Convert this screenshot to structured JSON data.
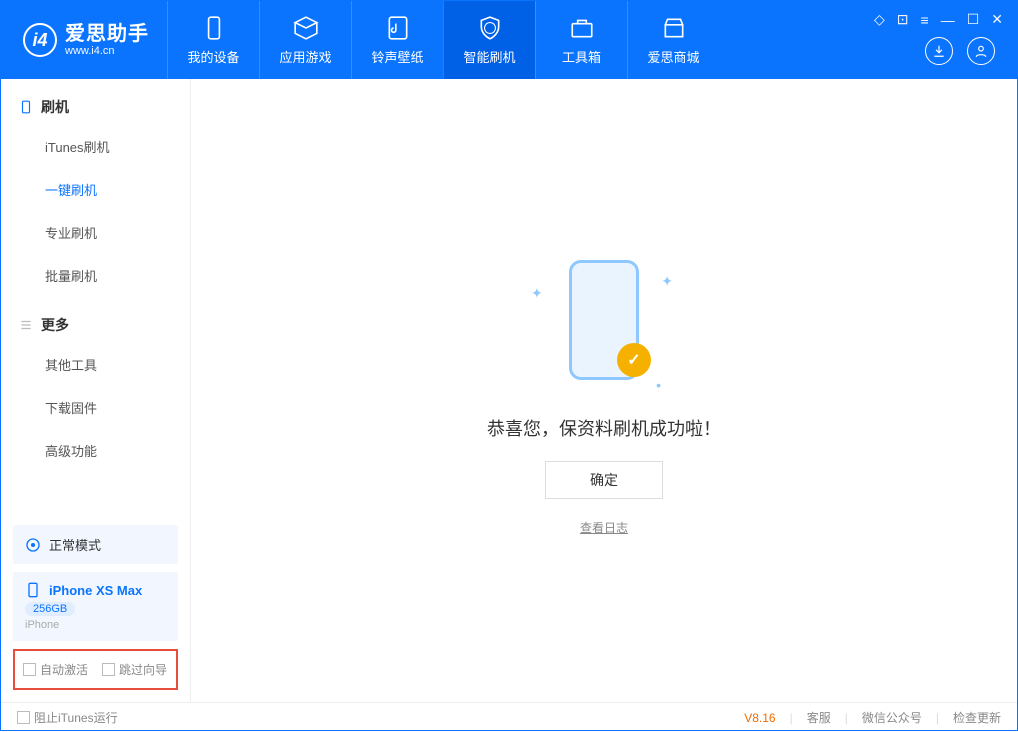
{
  "app": {
    "name": "爱思助手",
    "url": "www.i4.cn"
  },
  "nav": {
    "items": [
      {
        "label": "我的设备",
        "icon": "device"
      },
      {
        "label": "应用游戏",
        "icon": "cube"
      },
      {
        "label": "铃声壁纸",
        "icon": "music"
      },
      {
        "label": "智能刷机",
        "icon": "shield",
        "active": true
      },
      {
        "label": "工具箱",
        "icon": "toolbox"
      },
      {
        "label": "爱思商城",
        "icon": "shop"
      }
    ]
  },
  "sidebar": {
    "sections": [
      {
        "title": "刷机",
        "icon": "phone-icon",
        "items": [
          "iTunes刷机",
          "一键刷机",
          "专业刷机",
          "批量刷机"
        ],
        "active_index": 1
      },
      {
        "title": "更多",
        "icon": "list-icon",
        "items": [
          "其他工具",
          "下载固件",
          "高级功能"
        ]
      }
    ]
  },
  "device": {
    "mode_label": "正常模式",
    "name": "iPhone XS Max",
    "storage": "256GB",
    "type": "iPhone"
  },
  "options": {
    "auto_activate": "自动激活",
    "skip_guide": "跳过向导"
  },
  "main": {
    "success_message": "恭喜您，保资料刷机成功啦！",
    "ok_button": "确定",
    "log_link": "查看日志"
  },
  "footer": {
    "block_itunes": "阻止iTunes运行",
    "version": "V8.16",
    "links": [
      "客服",
      "微信公众号",
      "检查更新"
    ]
  }
}
